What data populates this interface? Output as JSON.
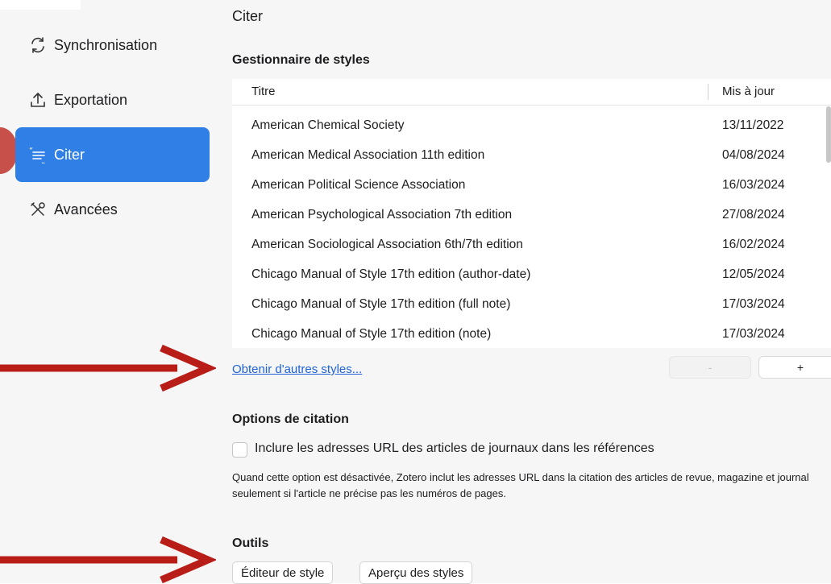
{
  "sidebar": {
    "items": [
      {
        "label": "Synchronisation",
        "icon": "sync-icon"
      },
      {
        "label": "Exportation",
        "icon": "export-icon"
      },
      {
        "label": "Citer",
        "icon": "cite-icon",
        "active": true
      },
      {
        "label": "Avancées",
        "icon": "tools-icon"
      }
    ],
    "accent_color": "#2f7fe6"
  },
  "main": {
    "title": "Citer",
    "style_manager": {
      "title": "Gestionnaire de styles",
      "columns": [
        "Titre",
        "Mis à jour"
      ],
      "rows": [
        {
          "title": "American Chemical Society",
          "date": "13/11/2022"
        },
        {
          "title": "American Medical Association 11th edition",
          "date": "04/08/2024"
        },
        {
          "title": "American Political Science Association",
          "date": "16/03/2024"
        },
        {
          "title": "American Psychological Association 7th edition",
          "date": "27/08/2024"
        },
        {
          "title": "American Sociological Association 6th/7th edition",
          "date": "16/02/2024"
        },
        {
          "title": "Chicago Manual of Style 17th edition (author-date)",
          "date": "12/05/2024"
        },
        {
          "title": "Chicago Manual of Style 17th edition (full note)",
          "date": "17/03/2024"
        },
        {
          "title": "Chicago Manual of Style 17th edition (note)",
          "date": "17/03/2024"
        }
      ],
      "get_more_link": "Obtenir d'autres styles...",
      "remove_label": "-",
      "add_label": "+"
    },
    "citation_options": {
      "title": "Options de citation",
      "checkbox_label": "Inclure les adresses URL des articles de journaux dans les références",
      "checked": false,
      "description": "Quand cette option est désactivée, Zotero inclut les adresses URL dans la citation des articles de revue, magazine et journal seulement si l'article ne précise pas les numéros de pages."
    },
    "tools": {
      "title": "Outils",
      "buttons": [
        "Éditeur de style",
        "Aperçu des styles"
      ]
    }
  },
  "annotation_color": "#b81d18"
}
